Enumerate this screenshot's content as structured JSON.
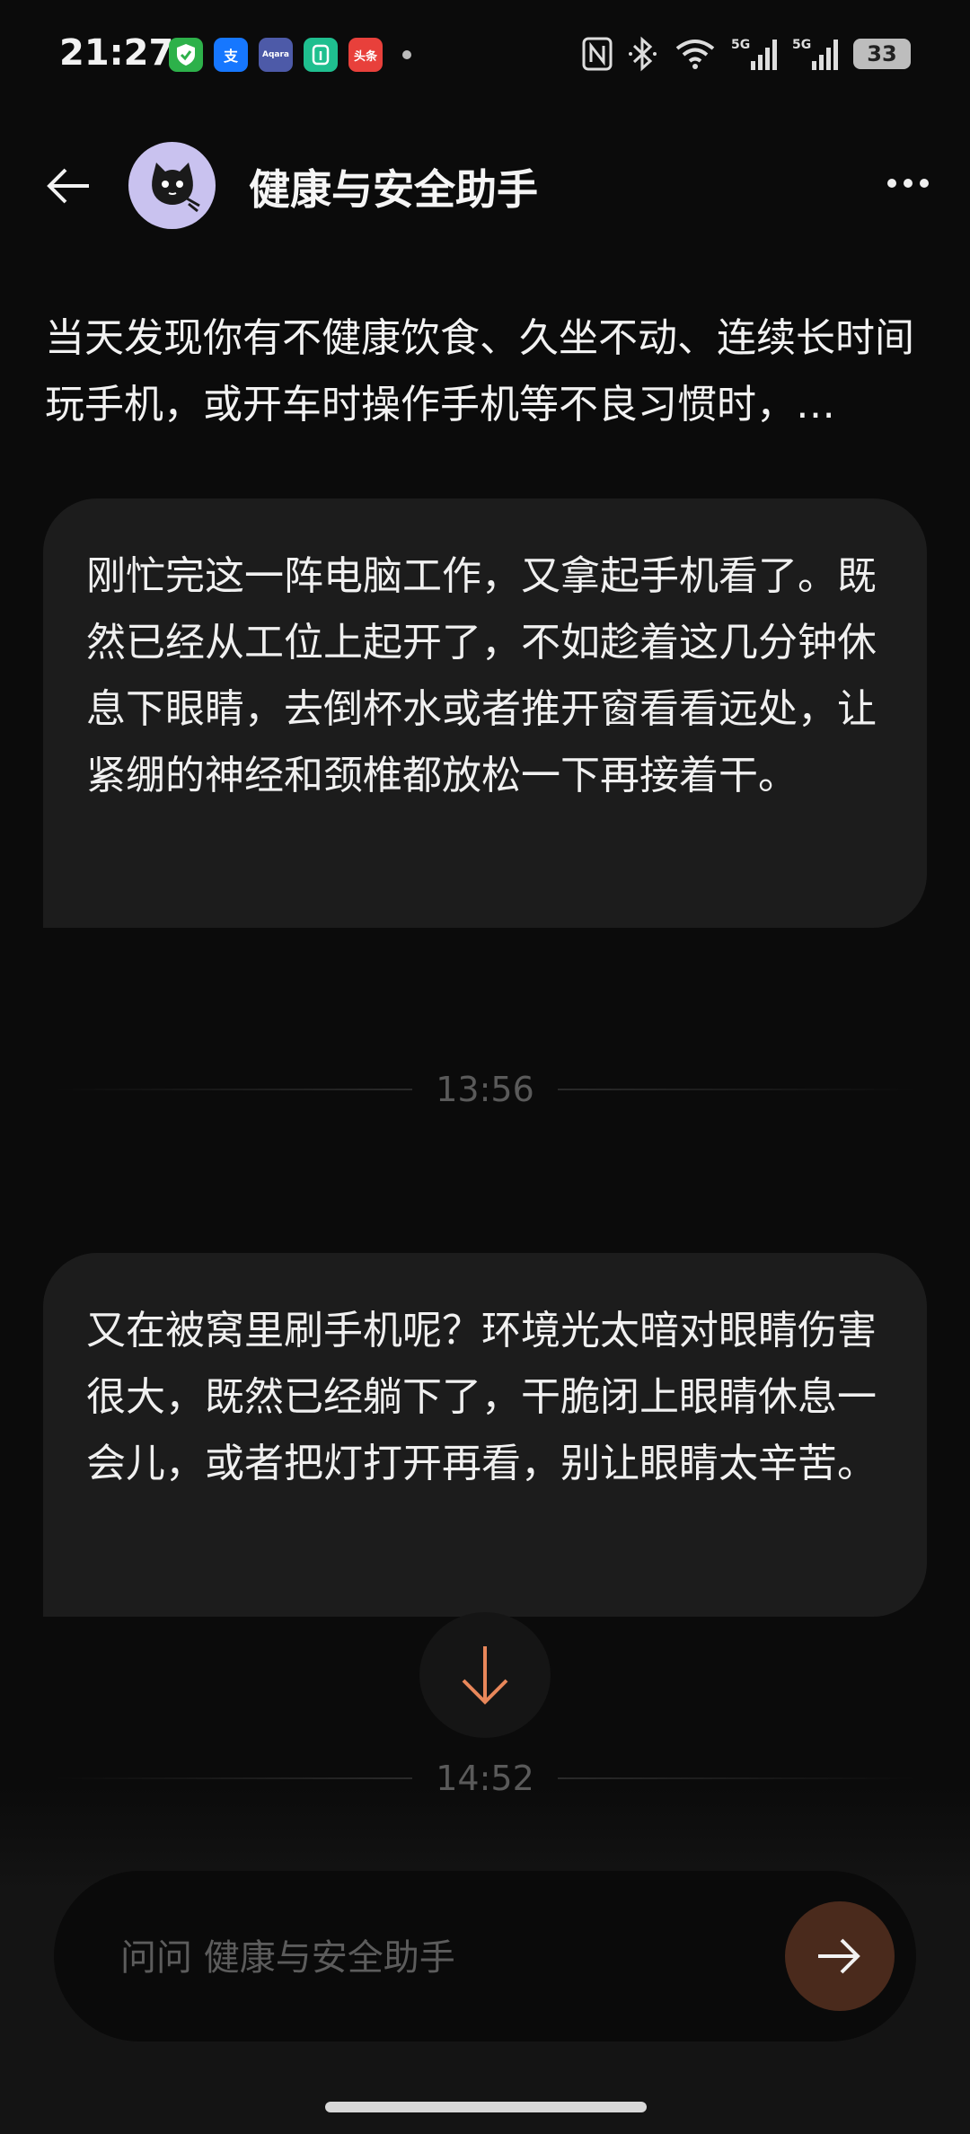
{
  "status_bar": {
    "time": "21:27",
    "app_icons": [
      {
        "name": "shield-app-icon",
        "color": "#2db14a",
        "glyph": "✓"
      },
      {
        "name": "alipay-app-icon",
        "color": "#1677ff",
        "glyph": "支"
      },
      {
        "name": "aqara-app-icon",
        "color": "#4d5aa8",
        "glyph": "Aqara"
      },
      {
        "name": "mijia-app-icon",
        "color": "#1fbf8f",
        "glyph": "米"
      },
      {
        "name": "toutiao-app-icon",
        "color": "#e8403b",
        "glyph": "头条"
      }
    ],
    "battery": "33"
  },
  "header": {
    "title": "健康与安全助手"
  },
  "intro_text": "当天发现你有不健康饮食、久坐不动、连续长时间玩手机，或开车时操作手机等不良习惯时，…",
  "messages": [
    {
      "text": "刚忙完这一阵电脑工作，又拿起手机看了。既然已经从工位上起开了，不如趁着这几分钟休息下眼睛，去倒杯水或者推开窗看看远处，让紧绷的神经和颈椎都放松一下再接着干。"
    },
    {
      "text": "又在被窝里刷手机呢？环境光太暗对眼睛伤害很大，既然已经躺下了，干脆闭上眼睛休息一会儿，或者把灯打开再看，别让眼睛太辛苦。"
    }
  ],
  "timestamps": [
    "13:56",
    "14:52"
  ],
  "input": {
    "placeholder": "问问 健康与安全助手"
  },
  "colors": {
    "accent": "#e8875a",
    "send_button_bg": "#4a2a1c",
    "bubble_bg": "#1c1c1c"
  }
}
